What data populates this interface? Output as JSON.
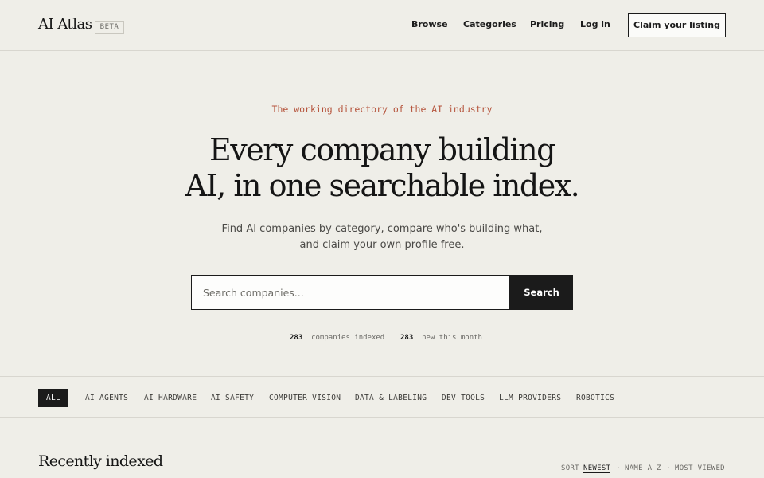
{
  "header": {
    "logo": "AI Atlas",
    "badge": "BETA",
    "nav": [
      "Browse",
      "Categories",
      "Pricing",
      "Log in"
    ],
    "cta": "Claim your listing"
  },
  "hero": {
    "eyebrow": "The working directory of the AI industry",
    "headline_line1": "Every company building",
    "headline_line2": "AI, in one searchable index.",
    "subhead_line1": "Find AI companies by category, compare who's building what,",
    "subhead_line2": "and claim your own profile free.",
    "search_placeholder": "Search companies...",
    "search_button": "Search",
    "stats": [
      {
        "value": "283",
        "label": "companies indexed"
      },
      {
        "value": "283",
        "label": "new this month"
      }
    ]
  },
  "categories": {
    "selected": "ALL",
    "items": [
      "ALL",
      "AI AGENTS",
      "AI HARDWARE",
      "AI SAFETY",
      "COMPUTER VISION",
      "DATA & LABELING",
      "DEV TOOLS",
      "LLM PROVIDERS",
      "ROBOTICS"
    ]
  },
  "recent": {
    "title": "Recently indexed",
    "sort_label": "SORT",
    "sort_options": [
      "NEWEST",
      "NAME A–Z",
      "MOST VIEWED"
    ],
    "sort_selected": "NEWEST",
    "separator": "·"
  }
}
